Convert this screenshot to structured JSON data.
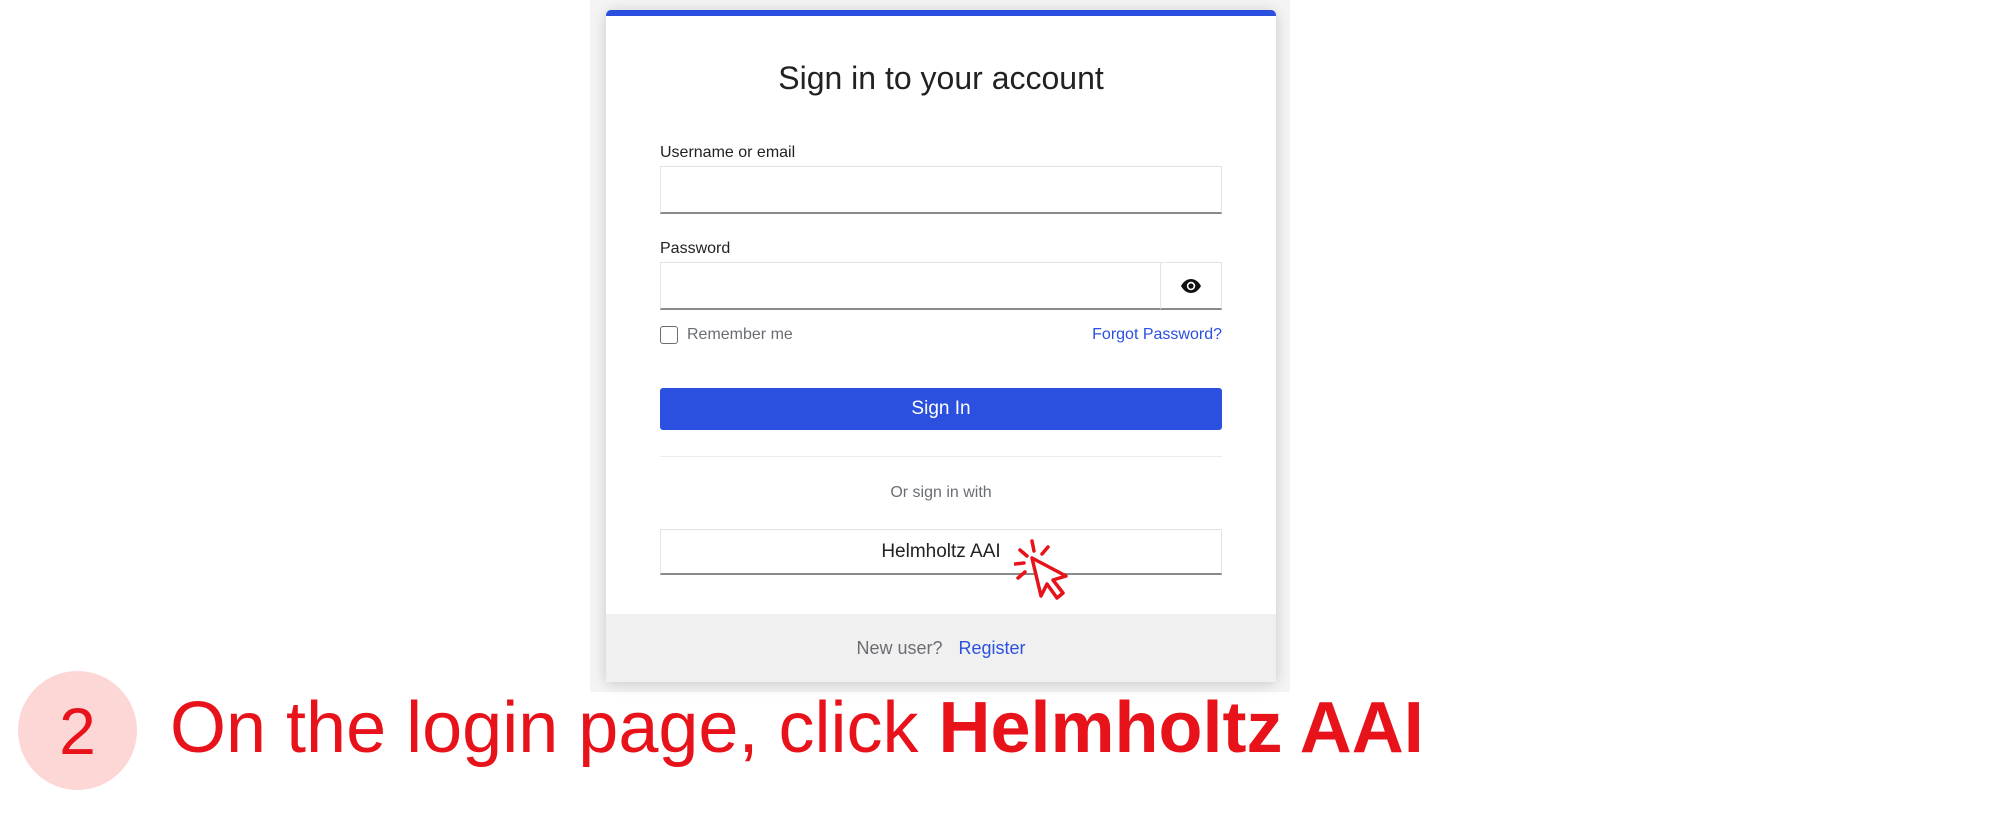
{
  "login": {
    "title": "Sign in to your account",
    "username_label": "Username or email",
    "username_value": "",
    "password_label": "Password",
    "password_value": "",
    "show_password_icon": "eye-icon",
    "remember_label": "Remember me",
    "remember_checked": false,
    "forgot_link": "Forgot Password?",
    "signin_button": "Sign In",
    "or_text": "Or sign in with",
    "idp_button": "Helmholtz AAI",
    "new_user_text": "New user?",
    "register_link": "Register"
  },
  "instruction": {
    "step_number": "2",
    "text_prefix": "On the login page, click ",
    "text_bold": "Helmholtz AAI"
  },
  "colors": {
    "primary": "#2b50e0",
    "highlight": "#e8121a",
    "step_bg": "#fdd6d6"
  },
  "icons": {
    "cursor": "click-pointer-icon"
  }
}
